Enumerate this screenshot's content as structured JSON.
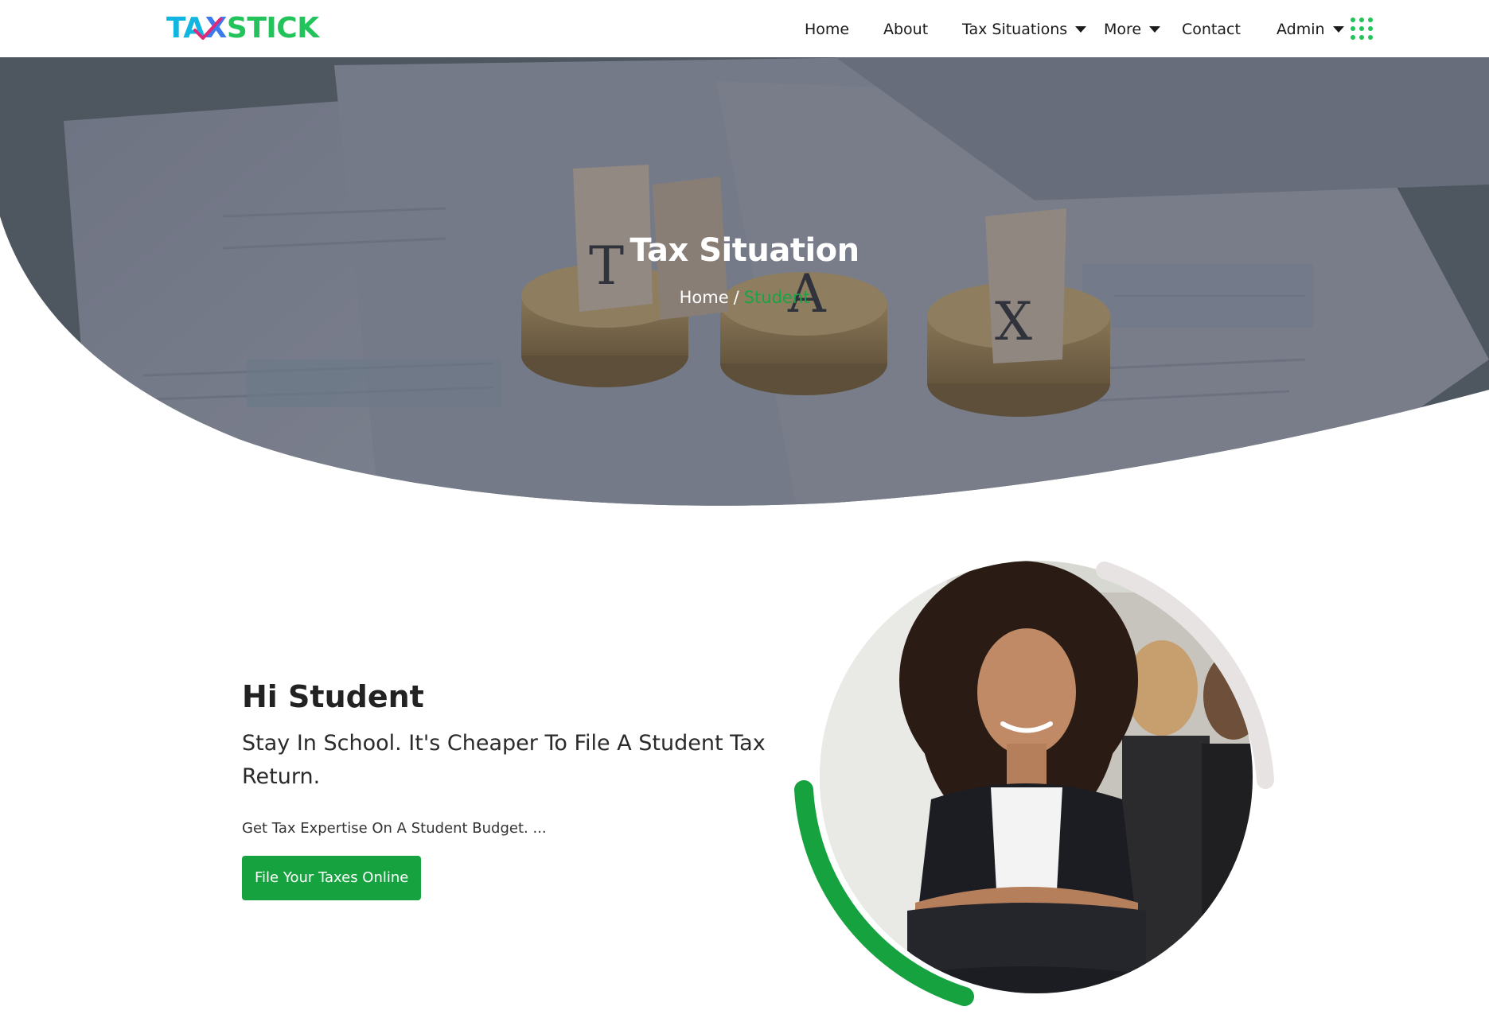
{
  "brand": {
    "logo_text_a": "TA",
    "logo_text_b": "X",
    "logo_text_c": "STICK"
  },
  "nav": {
    "items": [
      {
        "label": "Home"
      },
      {
        "label": "About"
      },
      {
        "label": "Tax Situations",
        "has_dropdown": true
      },
      {
        "label": "More",
        "has_dropdown": true
      },
      {
        "label": "Contact"
      },
      {
        "label": "Admin",
        "has_dropdown": true
      }
    ],
    "apps_icon": "grid-dots-icon"
  },
  "hero": {
    "title": "Tax Situation",
    "breadcrumb": {
      "home": "Home",
      "separator": "/",
      "current": "Student"
    },
    "image": "tax-blocks-on-coins-photo"
  },
  "main": {
    "heading": "Hi Student",
    "subheading": "Stay In School. It's Cheaper To File A Student Tax Return.",
    "blurb": "Get Tax Expertise On A Student Budget. ...",
    "cta_label": "File Your Taxes Online",
    "portrait": "smiling-woman-portrait-photo"
  },
  "colors": {
    "accent_green": "#16a23e",
    "logo_cyan": "#12b5e0",
    "logo_green": "#22c35a",
    "arc_grey": "#e8e3e3"
  }
}
